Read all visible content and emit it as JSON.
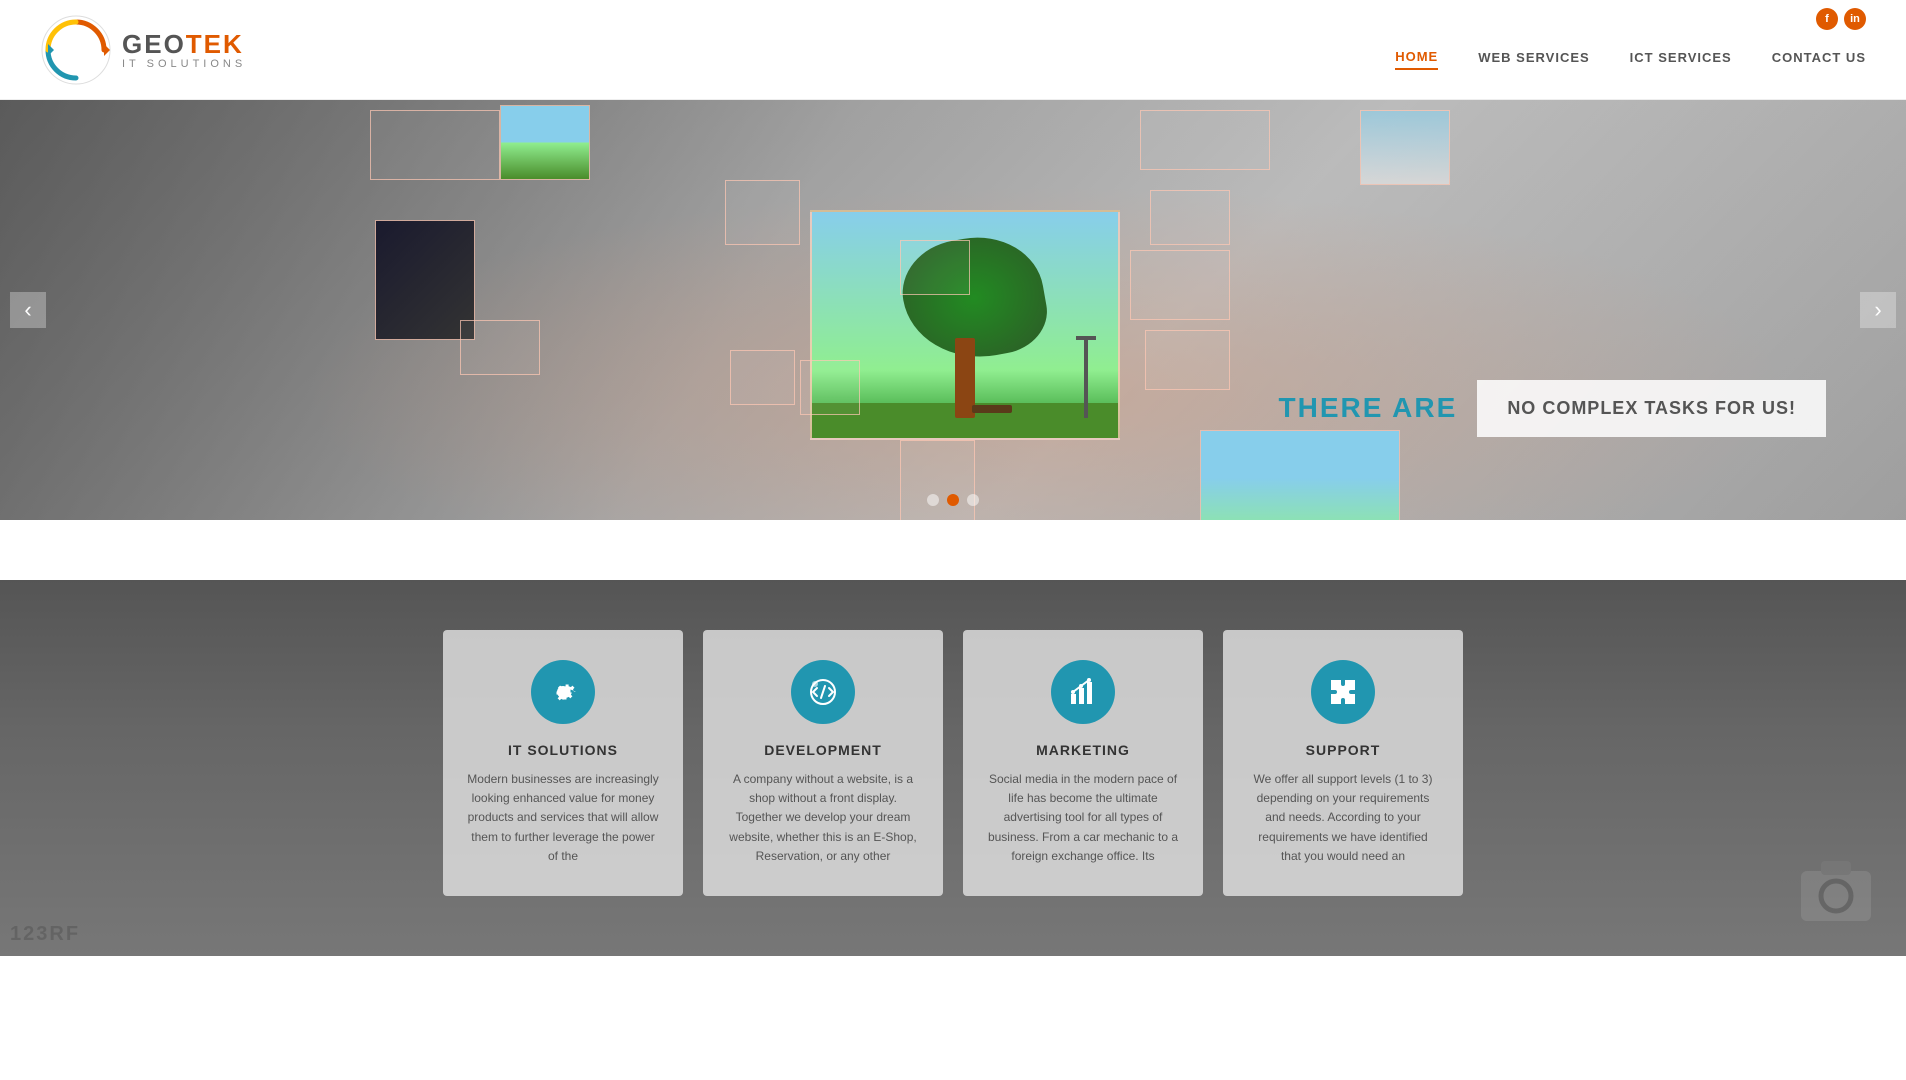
{
  "header": {
    "logo": {
      "geo": "GEO",
      "tek": "TEK",
      "sub": "IT SOLUTIONS"
    },
    "nav": {
      "items": [
        {
          "label": "HOME",
          "active": true
        },
        {
          "label": "WEB SERVICES",
          "active": false
        },
        {
          "label": "ICT SERVICES",
          "active": false
        },
        {
          "label": "CONTACT US",
          "active": false
        }
      ]
    },
    "social": {
      "icon1": "f",
      "icon2": "in"
    }
  },
  "hero": {
    "slide_text": {
      "there_are": "THERE ARE",
      "tagline": "NO COMPLEX TASKS FOR US!"
    },
    "dots": [
      {
        "active": false
      },
      {
        "active": true
      },
      {
        "active": false
      }
    ],
    "prev_label": "‹",
    "next_label": "›"
  },
  "services": {
    "cards": [
      {
        "id": "it-solutions",
        "title": "IT SOLUTIONS",
        "desc": "Modern businesses are increasingly looking enhanced value for money products and services that will allow them to further leverage the power of the",
        "icon": "gear"
      },
      {
        "id": "development",
        "title": "DEVELOPMENT",
        "desc": "A company without a website, is a shop without a front display. Together we develop your dream website, whether this is an E-Shop, Reservation, or any other",
        "icon": "code"
      },
      {
        "id": "marketing",
        "title": "MARKETING",
        "desc": "Social media in the modern pace of life has become the ultimate advertising tool for all types of business. From a car mechanic to a foreign exchange office. Its",
        "icon": "chart"
      },
      {
        "id": "support",
        "title": "SUPPORT",
        "desc": "We offer all support levels (1 to 3) depending on your requirements and needs. According to your requirements we have identified that you would need an",
        "icon": "puzzle"
      }
    ]
  }
}
